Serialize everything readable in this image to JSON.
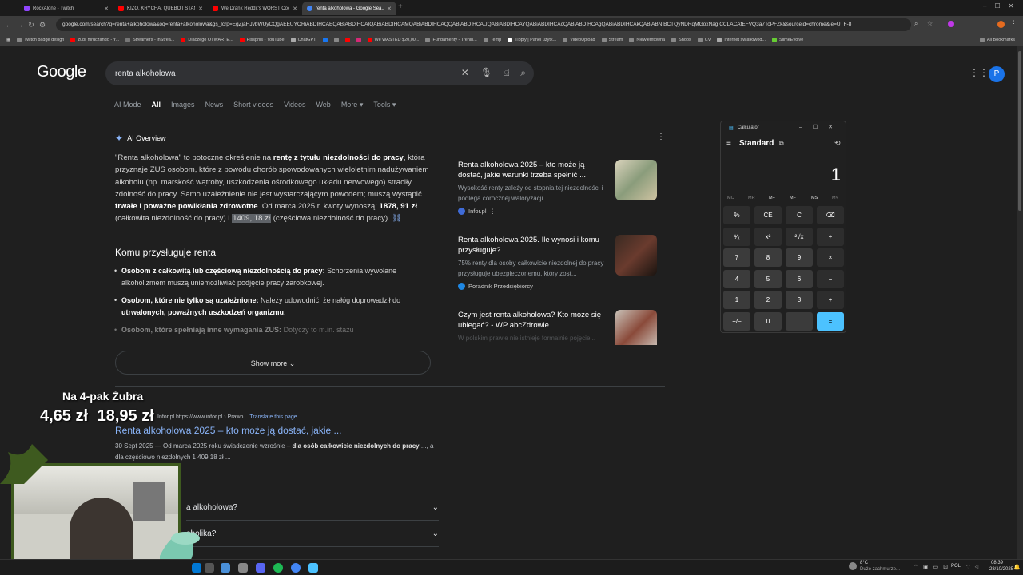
{
  "browser": {
    "tabs": [
      {
        "title": "RockAlone - Twitch",
        "color": "#9146ff"
      },
      {
        "title": "KIZO, KRYCHA, QUEBO I STANIS...",
        "color": "#ff0000"
      },
      {
        "title": "We Drank Reddit's WORST Coc...",
        "color": "#ff0000"
      },
      {
        "title": "renta alkoholowa - Google Sea...",
        "color": "#4285f4"
      }
    ],
    "url": "google.com/search?q=renta+alkoholowa&oq=renta+alkoholowa&gs_lcrp=EgZjaHJvbWUyCQgAEEUYORiABDIHCAEQABiABDIHCAIQABiABDIHCAMQABiABDIHCAQQABiABDIHCAUQABiABDIHCAYQABiABDIHCAcQABiABDIHCAgQABiABDIHCAkQABiABNIBCTQyNDRqMGoxNag CCLACAfEFVQ3a7ToPFZk&sourceid=chrome&ie=UTF-8",
    "bookmarks": [
      "Twitch badge design",
      "zubr mruczando - Y...",
      "Streamers - inStrea...",
      "Dlaczego OTWARTE...",
      "Pissphis - YouTube",
      "ChatGPT",
      "We WASTED $20,00...",
      "Fundamenty - Trenin...",
      "Temp",
      "Tipply | Panel użytk...",
      "VideoUpload",
      "Stream",
      "Niewiemtbwna",
      "Shops",
      "CV",
      "Internet światłowod...",
      "SlimeEvolve",
      "All Bookmarks"
    ]
  },
  "google": {
    "logo": "Google",
    "query": "renta alkoholowa",
    "avatar": "P",
    "tabs": [
      "AI Mode",
      "All",
      "Images",
      "News",
      "Short videos",
      "Videos",
      "Web",
      "More ▾",
      "Tools ▾"
    ],
    "ai_overview_label": "AI Overview",
    "para_parts": {
      "a": "\"Renta alkoholowa\" to potoczne określenie na ",
      "b": "rentę z tytułu niezdolności do pracy",
      "c": ", którą przyznaje ZUS osobom, które z powodu chorób spowodowanych wieloletnim nadużywaniem alkoholu (np. marskość wątroby, uszkodzenia ośrodkowego układu nerwowego) straciły zdolność do pracy. Samo uzależnienie nie jest wystarczającym powodem; muszą wystąpić ",
      "d": "trwałe i poważne powikłania zdrowotne",
      "e": ". Od marca 2025 r. kwoty wynoszą: ",
      "f": "1878, 91 zł",
      "g": " (całkowita niezdolność do pracy) i ",
      "h": "1409, 18 zł",
      "i": " (częściowa niezdolność do pracy)."
    },
    "section_title": "Komu przysługuje renta",
    "bullets": [
      {
        "bold": "Osobom z całkowitą lub częściową niezdolnością do pracy:",
        "text": " Schorzenia wywołane alkoholizmem muszą uniemożliwiać podjęcie pracy zarobkowej."
      },
      {
        "bold": "Osobom, które nie tylko są uzależnione:",
        "text": " Należy udowodnić, że nałóg doprowadził do ",
        "bold2": "utrwalonych, poważnych uszkodzeń organizmu",
        "text2": "."
      },
      {
        "bold": "Osobom, które spełniają inne wymagania ZUS:",
        "text": " Dotyczy to m.in. stażu"
      }
    ],
    "show_more": "Show more",
    "cards": [
      {
        "title": "Renta alkoholowa 2025 – kto może ją dostać, jakie warunki trzeba spełnić ...",
        "snippet": "Wysokość renty zależy od stopnia tej niezdolności i podlega corocznej waloryzacji....",
        "source": "Infor.pl"
      },
      {
        "title": "Renta alkoholowa 2025. Ile wynosi i komu przysługuje?",
        "snippet": "75% renty dla osoby całkowicie niezdolnej do pracy przysługuje ubezpieczonemu, który zost...",
        "source": "Poradnik Przedsiębiorcy"
      },
      {
        "title": "Czym jest renta alkoholowa? Kto może się ubiegać? - WP abcZdrowie",
        "snippet": "W polskim prawie nie istnieje formalnie pojęcie...",
        "source": ""
      }
    ],
    "result": {
      "site": "Infor.pl",
      "url_path": "https://www.infor.pl › Prawo",
      "translate": "Translate this page",
      "title": "Renta alkoholowa 2025 – kto może ją dostać, jakie ...",
      "date": "30 Sept 2025",
      "snip_a": " — Od marca 2025 roku świadczenie wzrośnie – ",
      "snip_b": "dla osób całkowicie niezdolnych do pracy",
      "snip_c": " ..., a dla częściowo niezdolnych 1 409,18 zł ..."
    },
    "paa": [
      "a alkoholowa?",
      "oholika?"
    ]
  },
  "overlay": {
    "title": "Na 4-pak Żubra",
    "price_a": "4,65 zł",
    "price_b": "18,95 zł"
  },
  "calculator": {
    "title": "Calculator",
    "mode": "Standard",
    "display": "1",
    "memory": [
      "MC",
      "MR",
      "M+",
      "M−",
      "MS",
      "M˅"
    ],
    "buttons": [
      "%",
      "CE",
      "C",
      "⌫",
      "¹⁄ₓ",
      "x²",
      "²√x",
      "÷",
      "7",
      "8",
      "9",
      "×",
      "4",
      "5",
      "6",
      "−",
      "1",
      "2",
      "3",
      "+",
      "+/−",
      "0",
      ".",
      "="
    ]
  },
  "taskbar": {
    "weather_temp": "8°C",
    "weather_desc": "Duże zachmurze...",
    "lang": "POL",
    "time": "08:39",
    "date": "28/10/2025"
  }
}
